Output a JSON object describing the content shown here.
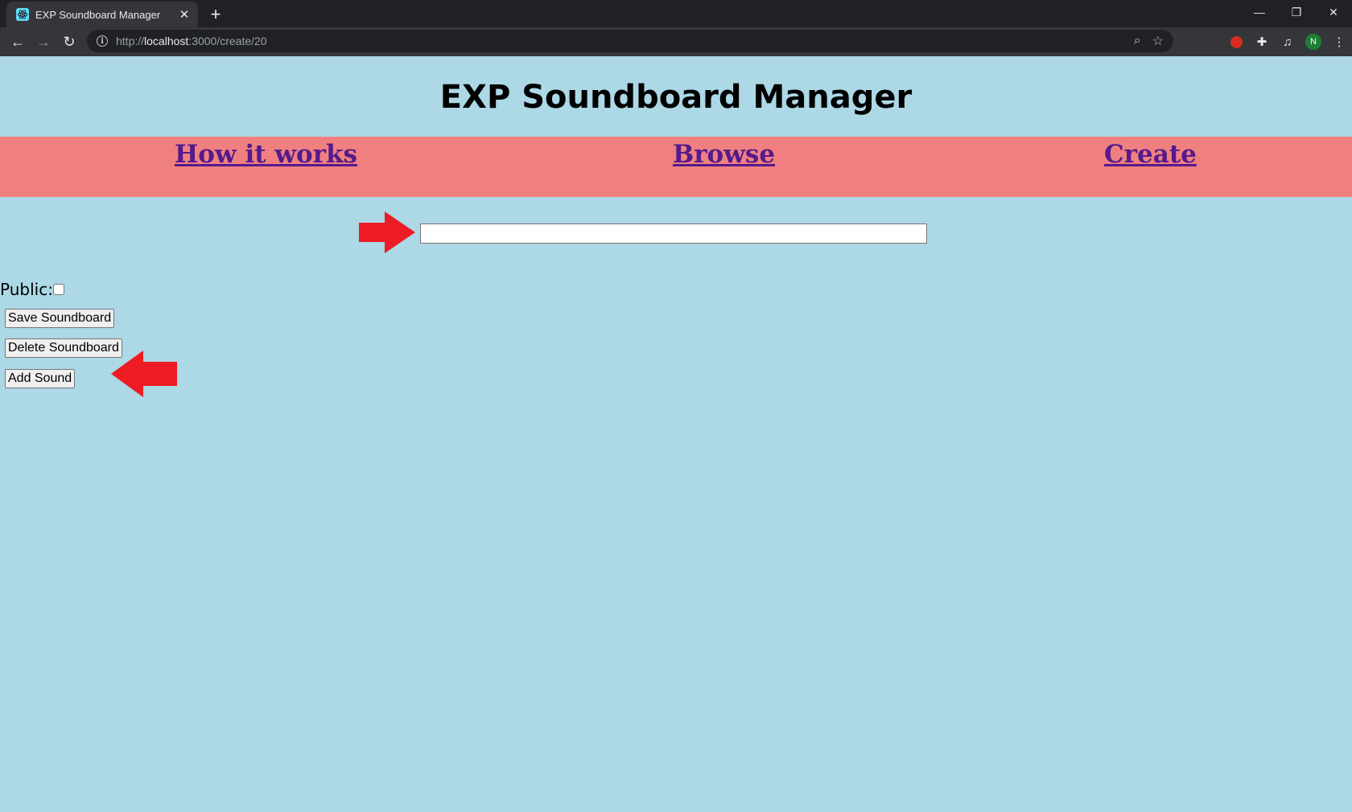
{
  "browser": {
    "tab_title": "EXP Soundboard Manager",
    "url_scheme": "http://",
    "url_host": "localhost",
    "url_path": ":3000/create/20",
    "avatar_letter": "N"
  },
  "page": {
    "title": "EXP Soundboard Manager",
    "nav": {
      "how_it_works": "How it works",
      "browse": "Browse",
      "create": "Create"
    },
    "soundboard_name_input": {
      "value": "",
      "placeholder": ""
    },
    "public_label": "Public:",
    "public_checked": false,
    "save_button": "Save Soundboard",
    "delete_button": "Delete Soundboard",
    "add_sound_button": "Add Sound"
  },
  "colors": {
    "page_background": "#add8e6",
    "navbar_background": "#f08080",
    "link_color": "#551a8b",
    "annotation_arrow": "#ed1c24"
  }
}
